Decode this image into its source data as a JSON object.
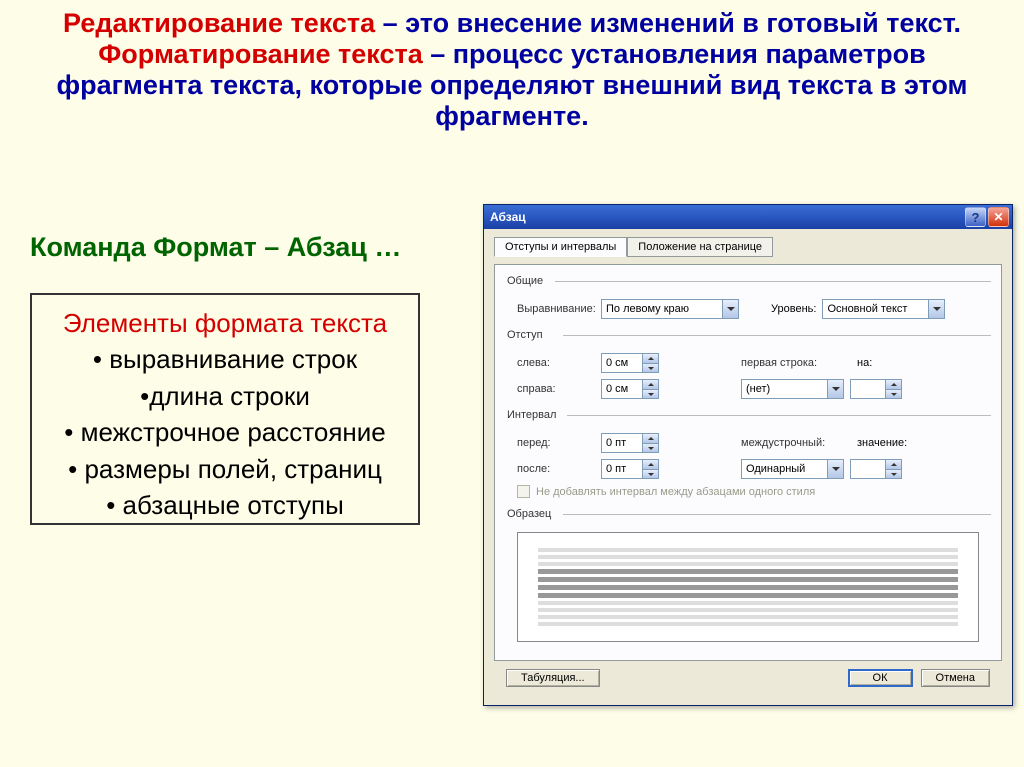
{
  "headline": {
    "part1a": "Редактирование текста",
    "part1b": " – это внесение изменений в готовый текст.",
    "part2a": "Форматирование текста",
    "part2b": " – процесс установления параметров фрагмента текста, которые определяют внешний вид текста в этом фрагменте."
  },
  "command_line": "Команда Формат – Абзац …",
  "box": {
    "title": "Элементы формата текста",
    "items": [
      "выравнивание строк",
      "длина строки",
      "межстрочное расстояние",
      "размеры полей, страниц",
      "абзацные отступы"
    ]
  },
  "dialog": {
    "title": "Абзац",
    "tab1": "Отступы и интервалы",
    "tab2": "Положение на странице",
    "groups": {
      "general": "Общие",
      "indent": "Отступ",
      "spacing": "Интервал",
      "preview": "Образец"
    },
    "labels": {
      "alignment": "Выравнивание:",
      "level": "Уровень:",
      "left": "слева:",
      "right": "справа:",
      "firstline": "первая строка:",
      "on": "на:",
      "before": "перед:",
      "after": "после:",
      "linespacing": "междустрочный:",
      "value": "значение:"
    },
    "values": {
      "alignment": "По левому краю",
      "level": "Основной текст",
      "left": "0 см",
      "right": "0 см",
      "firstline": "(нет)",
      "on": "",
      "before": "0 пт",
      "after": "0 пт",
      "linespacing": "Одинарный",
      "val": ""
    },
    "checkbox": "Не добавлять интервал между абзацами одного стиля",
    "buttons": {
      "tabs": "Табуляция...",
      "ok": "ОК",
      "cancel": "Отмена"
    }
  }
}
